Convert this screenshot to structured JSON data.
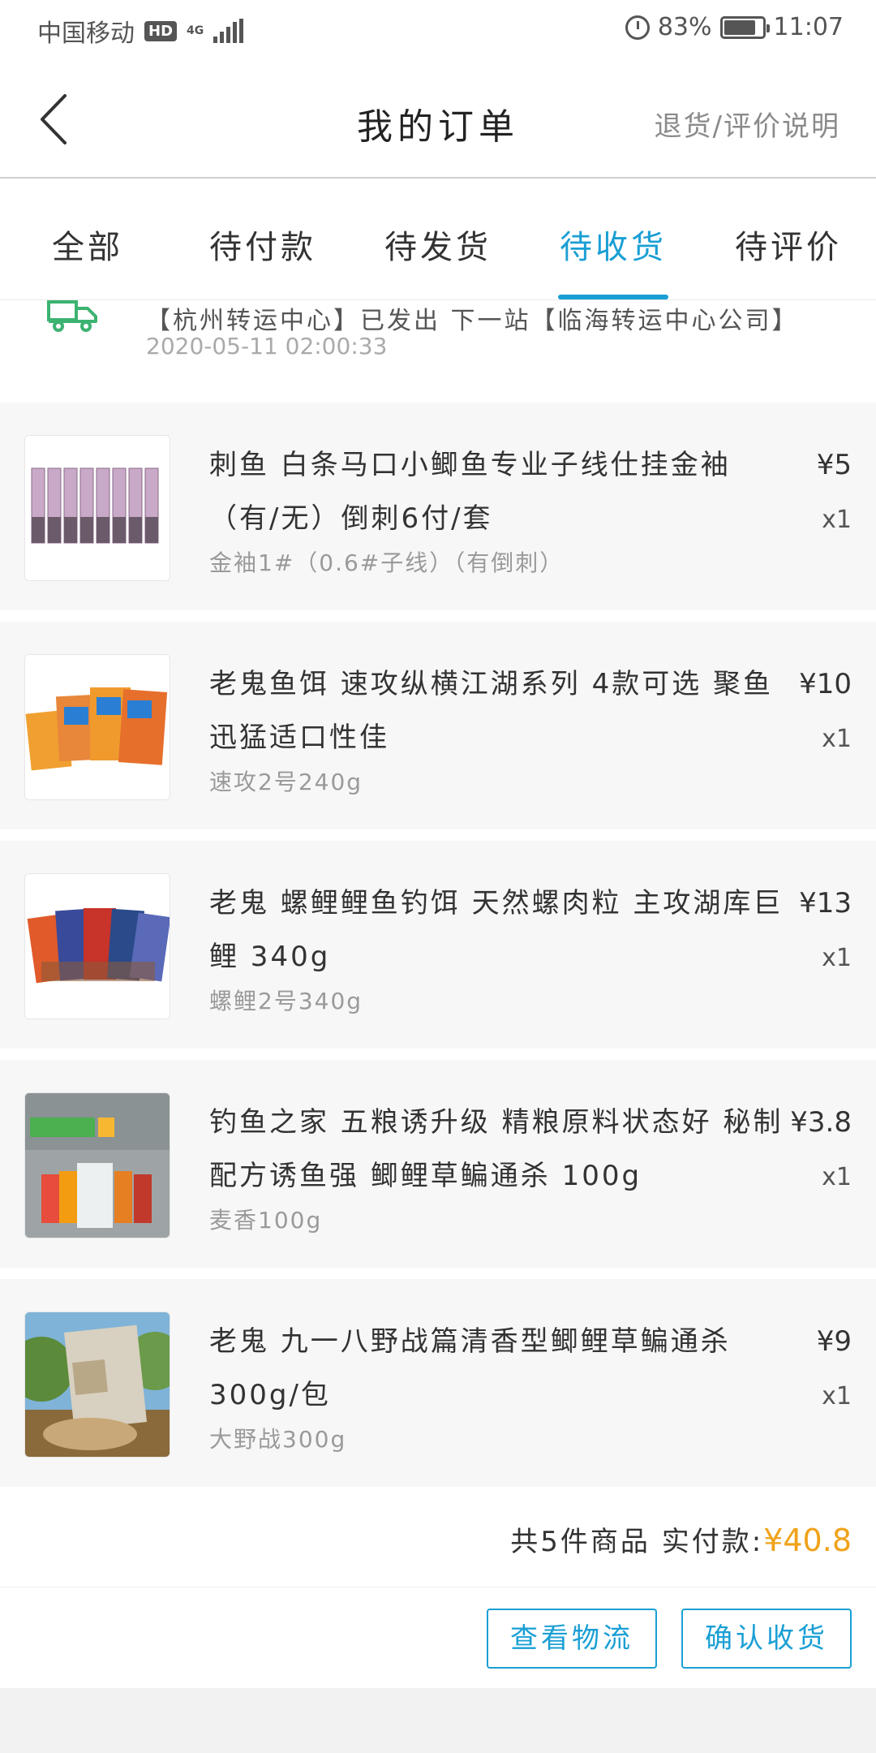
{
  "status_bar": {
    "carrier": "中国移动",
    "hd": "HD",
    "network": "4G",
    "battery_text": "83%",
    "time": "11:07"
  },
  "header": {
    "title": "我的订单",
    "help_link": "退货/评价说明"
  },
  "tabs": [
    {
      "label": "全部",
      "active": false
    },
    {
      "label": "待付款",
      "active": false
    },
    {
      "label": "待发货",
      "active": false
    },
    {
      "label": "待收货",
      "active": true
    },
    {
      "label": "待评价",
      "active": false
    }
  ],
  "logistics": {
    "text": "【杭州转运中心】已发出 下一站【临海转运中心公司】",
    "time": "2020-05-11 02:00:33"
  },
  "products": [
    {
      "title": "刺鱼 白条马口小鲫鱼专业子线仕挂金袖（有/无）倒刺6付/套",
      "spec": "金袖1#（0.6#子线）（有倒刺）",
      "price": "¥5",
      "qty": "x1"
    },
    {
      "title": "老鬼鱼饵 速攻纵横江湖系列 4款可选 聚鱼迅猛适口性佳",
      "spec": "速攻2号240g",
      "price": "¥10",
      "qty": "x1"
    },
    {
      "title": "老鬼 螺鲤鲤鱼钓饵 天然螺肉粒 主攻湖库巨鲤 340g",
      "spec": "螺鲤2号340g",
      "price": "¥13",
      "qty": "x1"
    },
    {
      "title": "钓鱼之家 五粮诱升级 精粮原料状态好 秘制配方诱鱼强 鲫鲤草鳊通杀 100g",
      "spec": "麦香100g",
      "price": "¥3.8",
      "qty": "x1"
    },
    {
      "title": "老鬼 九一八野战篇清香型鲫鲤草鳊通杀 300g/包",
      "spec": "大野战300g",
      "price": "¥9",
      "qty": "x1"
    }
  ],
  "summary": {
    "count_label": "共5件商品",
    "paid_label": "实付款:",
    "total": "¥40.8"
  },
  "actions": {
    "view_logistics": "查看物流",
    "confirm_receipt": "确认收货"
  },
  "colors": {
    "accent": "#1a9fd4",
    "price_highlight": "#f0a21a",
    "truck_icon": "#3cb371"
  }
}
